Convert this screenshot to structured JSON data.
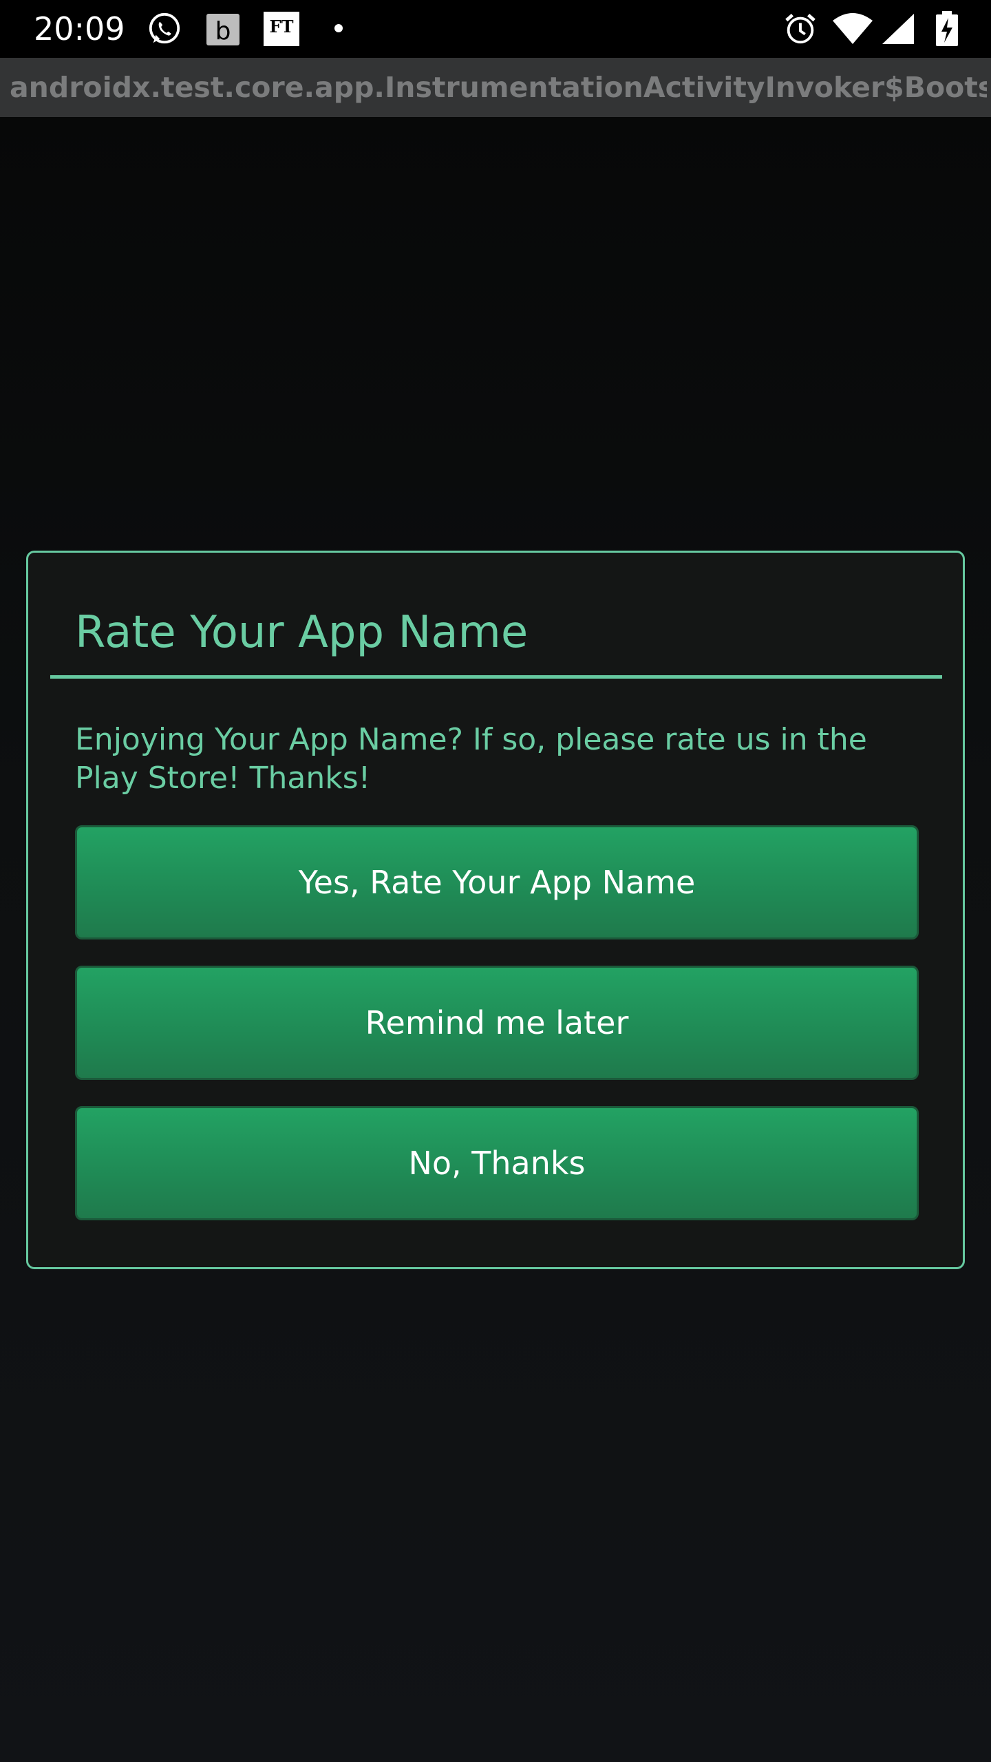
{
  "status_bar": {
    "time": "20:09",
    "icons": [
      "whatsapp-icon",
      "b-app-icon",
      "ft-icon",
      "notification-dot-icon",
      "alarm-icon",
      "wifi-icon",
      "signal-icon",
      "battery-charging-icon"
    ],
    "b_icon_letter": "b",
    "ft_icon_letters": "FT"
  },
  "title_bar": {
    "title": "androidx.test.core.app.InstrumentationActivityInvoker$Bootst…"
  },
  "dialog": {
    "title": "Rate Your App Name",
    "message": "Enjoying Your App Name? If so, please rate us in the Play Store! Thanks!",
    "buttons": [
      {
        "label": "Yes, Rate Your App Name"
      },
      {
        "label": "Remind me later"
      },
      {
        "label": "No, Thanks"
      }
    ]
  },
  "colors": {
    "accent": "#6acda3",
    "button": "#1f8a55",
    "dialog_background": "#141615",
    "background": "#0d0f10"
  }
}
